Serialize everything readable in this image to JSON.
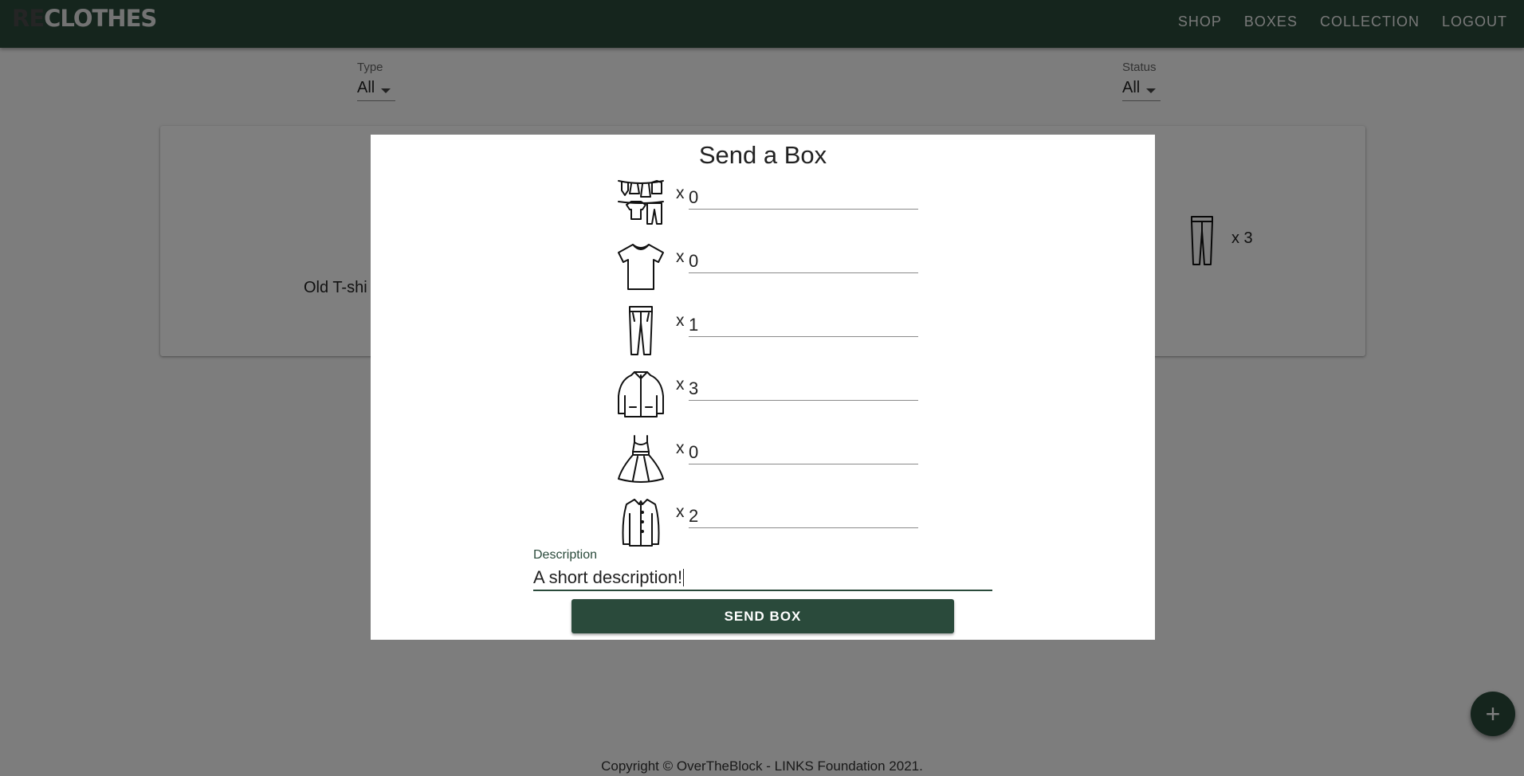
{
  "app": {
    "logo_prefix": "RE",
    "logo_suffix": "CLOTHES",
    "nav": [
      "SHOP",
      "BOXES",
      "COLLECTION",
      "LOGOUT"
    ]
  },
  "filters": {
    "type_label": "Type",
    "type_value": "All",
    "status_label": "Status",
    "status_value": "All"
  },
  "card": {
    "item_name": "Old T-shi",
    "item_qty": "x 3",
    "item_icon": "pants-icon"
  },
  "footer": {
    "copyright": "Copyright © OverTheBlock - LINKS Foundation 2021.",
    "fab_icon": "plus-icon"
  },
  "modal": {
    "title": "Send a Box",
    "multiplier": "x",
    "items": [
      {
        "icon": "laundry-icon",
        "value": "0"
      },
      {
        "icon": "tshirt-icon",
        "value": "0"
      },
      {
        "icon": "pants-icon",
        "value": "1"
      },
      {
        "icon": "jacket-icon",
        "value": "3"
      },
      {
        "icon": "dress-icon",
        "value": "0"
      },
      {
        "icon": "shirt-icon",
        "value": "2"
      }
    ],
    "description_label": "Description",
    "description_value": "A short description!",
    "send_label": "SEND BOX"
  },
  "colors": {
    "primary": "#2a4a3b",
    "overlay": "rgba(0,0,0,0.5)"
  }
}
